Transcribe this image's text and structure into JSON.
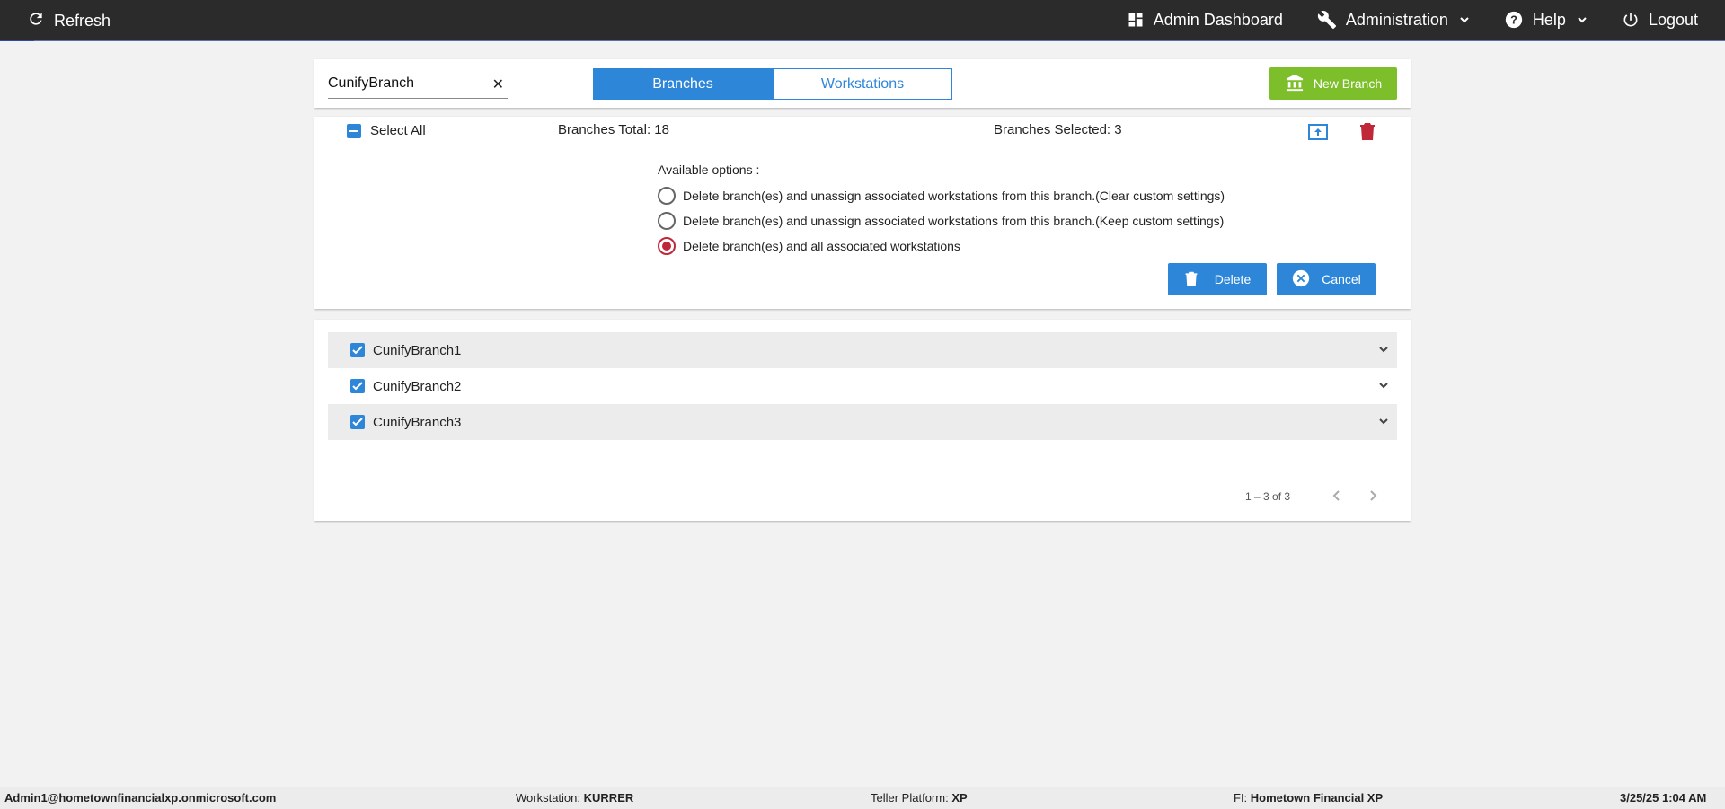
{
  "topbar": {
    "refresh_label": "Refresh",
    "admin_dashboard_label": "Admin Dashboard",
    "administration_label": "Administration",
    "help_label": "Help",
    "logout_label": "Logout"
  },
  "search": {
    "value": "CunifyBranch",
    "clear_glyph": "✕"
  },
  "tabs": [
    {
      "label": "Branches",
      "active": true
    },
    {
      "label": "Workstations",
      "active": false
    }
  ],
  "new_branch_label": "New Branch",
  "summary": {
    "select_all_label": "Select All",
    "branches_total": "Branches Total: 18",
    "branches_selected": "Branches Selected: 3"
  },
  "options": {
    "heading": "Available options :",
    "items": [
      {
        "label": "Delete branch(es) and unassign associated workstations from this branch.(Clear custom settings)",
        "selected": false
      },
      {
        "label": "Delete branch(es) and unassign associated workstations from this branch.(Keep custom settings)",
        "selected": false
      },
      {
        "label": "Delete branch(es) and all associated workstations",
        "selected": true
      }
    ],
    "delete_label": "Delete",
    "cancel_label": "Cancel"
  },
  "branches": [
    {
      "name": "CunifyBranch1",
      "checked": true
    },
    {
      "name": "CunifyBranch2",
      "checked": true
    },
    {
      "name": "CunifyBranch3",
      "checked": true
    }
  ],
  "pager": {
    "range": "1 – 3 of 3"
  },
  "status": {
    "user": "Admin1@hometownfinancialxp.onmicrosoft.com",
    "workstation_label": "Workstation:",
    "workstation_value": "KURRER",
    "platform_label": "Teller Platform:",
    "platform_value": "XP",
    "fi_label": "FI:",
    "fi_value": "Hometown Financial XP",
    "datetime": "3/25/25 1:04 AM"
  },
  "colors": {
    "topbar": "#2b2b2b",
    "primary": "#2d86d8",
    "new_branch": "#7cbf2a",
    "danger": "#c0283a"
  },
  "icons": [
    "refresh-icon",
    "dashboard-icon",
    "wrench-icon",
    "help-icon",
    "power-icon",
    "bank-icon",
    "upload-icon",
    "trash-icon",
    "cancel-circle-icon",
    "chevron-down-icon",
    "chevron-left-icon",
    "chevron-right-icon"
  ]
}
